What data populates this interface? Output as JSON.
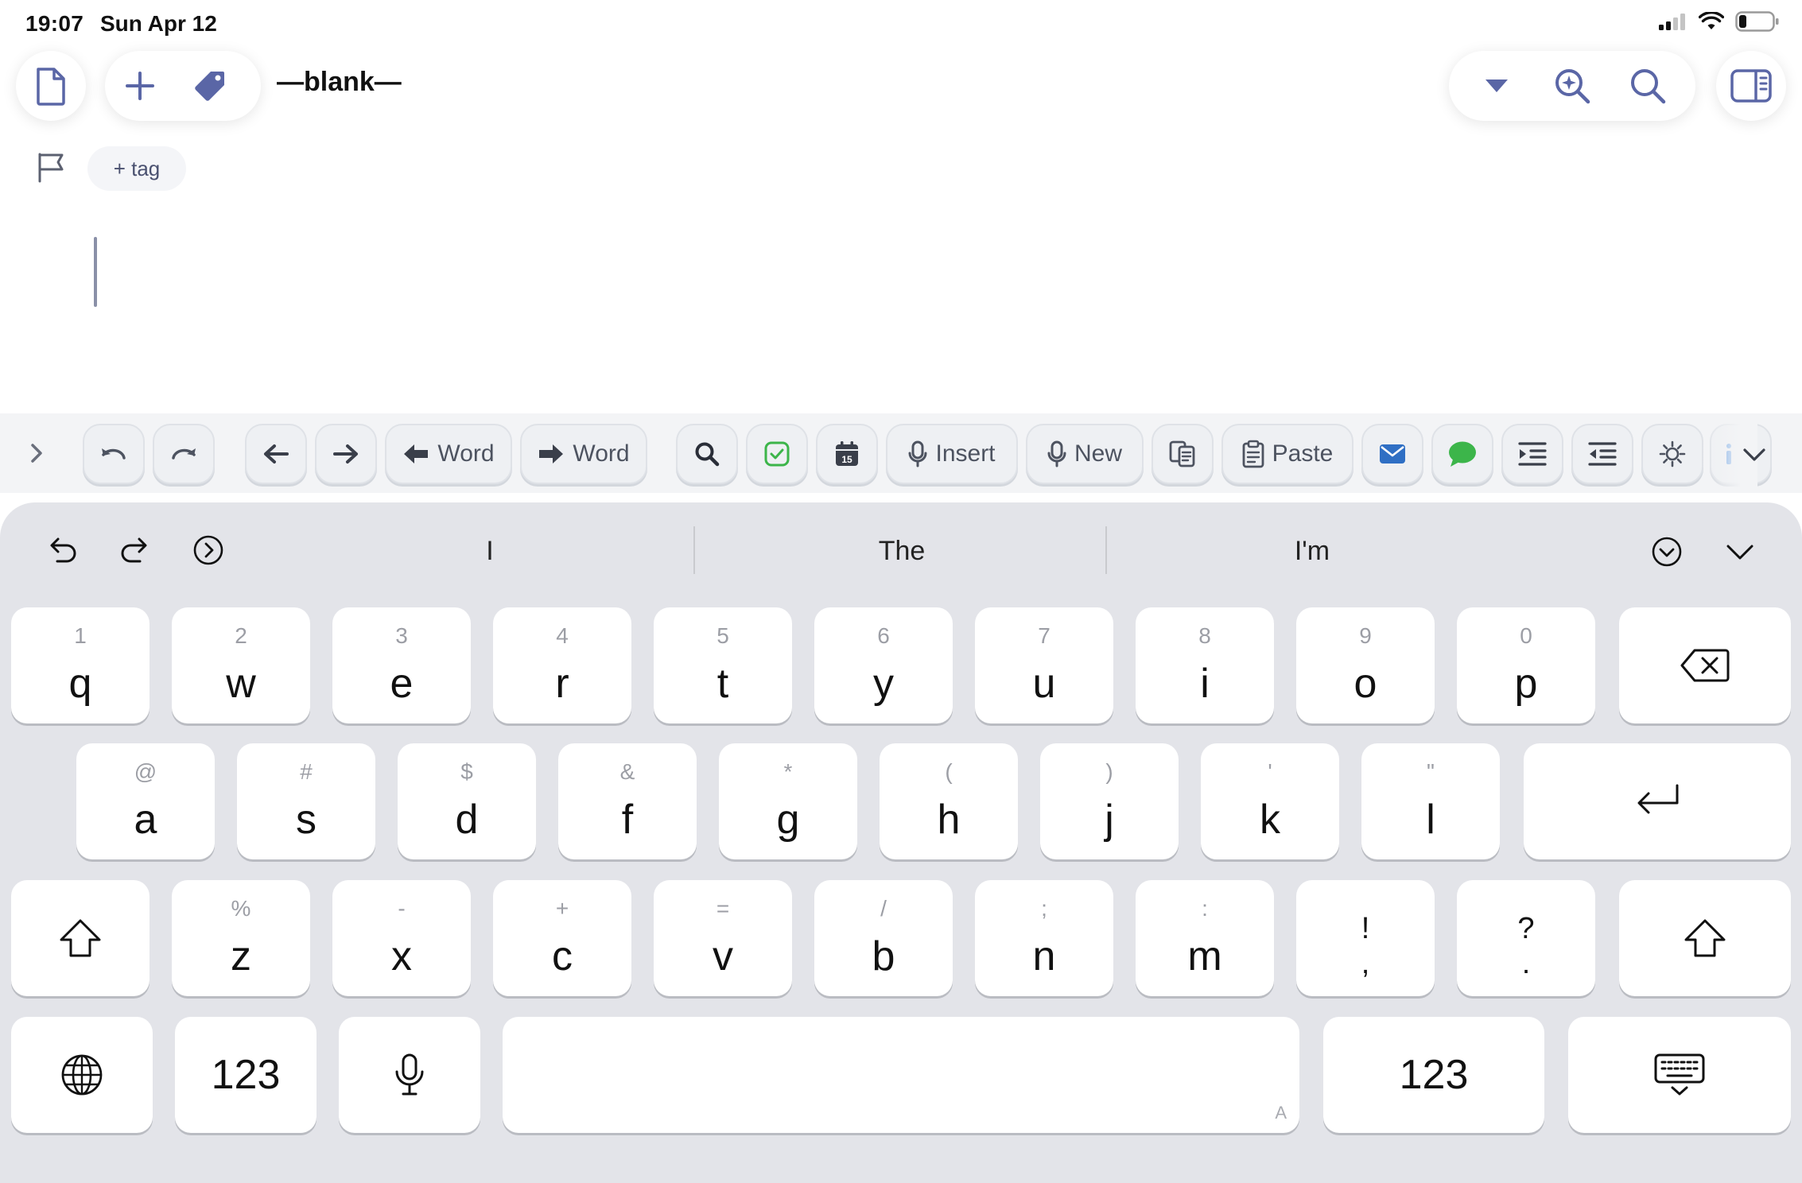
{
  "status": {
    "time": "19:07",
    "date": "Sun Apr 12"
  },
  "header": {
    "title": "—blank—"
  },
  "meta": {
    "tag_label": "+ tag"
  },
  "toolbar": {
    "prev_word_label": "Word",
    "next_word_label": "Word",
    "dictate_insert_label": "Insert",
    "dictate_new_label": "New",
    "paste_label": "Paste",
    "calendar_day": "15"
  },
  "keyboard": {
    "suggestions": [
      "I",
      "The",
      "I'm"
    ],
    "row1": [
      {
        "hint": "1",
        "key": "q"
      },
      {
        "hint": "2",
        "key": "w"
      },
      {
        "hint": "3",
        "key": "e"
      },
      {
        "hint": "4",
        "key": "r"
      },
      {
        "hint": "5",
        "key": "t"
      },
      {
        "hint": "6",
        "key": "y"
      },
      {
        "hint": "7",
        "key": "u"
      },
      {
        "hint": "8",
        "key": "i"
      },
      {
        "hint": "9",
        "key": "o"
      },
      {
        "hint": "0",
        "key": "p"
      }
    ],
    "row2": [
      {
        "hint": "@",
        "key": "a"
      },
      {
        "hint": "#",
        "key": "s"
      },
      {
        "hint": "$",
        "key": "d"
      },
      {
        "hint": "&",
        "key": "f"
      },
      {
        "hint": "*",
        "key": "g"
      },
      {
        "hint": "(",
        "key": "h"
      },
      {
        "hint": ")",
        "key": "j"
      },
      {
        "hint": "'",
        "key": "k"
      },
      {
        "hint": "\"",
        "key": "l"
      }
    ],
    "row3": [
      {
        "hint": "%",
        "key": "z"
      },
      {
        "hint": "-",
        "key": "x"
      },
      {
        "hint": "+",
        "key": "c"
      },
      {
        "hint": "=",
        "key": "v"
      },
      {
        "hint": "/",
        "key": "b"
      },
      {
        "hint": ";",
        "key": "n"
      },
      {
        "hint": ":",
        "key": "m"
      }
    ],
    "exclaim": {
      "top": "!",
      "bottom": ","
    },
    "question": {
      "top": "?",
      "bottom": "."
    },
    "numbers_label": "123",
    "space_mark": "A"
  },
  "colors": {
    "accent": "#5a66a6",
    "green": "#3cb54a",
    "mail_blue": "#2f6fc4",
    "toolbar_bg": "#f3f4f6",
    "keyboard_bg": "#e3e4e9"
  }
}
